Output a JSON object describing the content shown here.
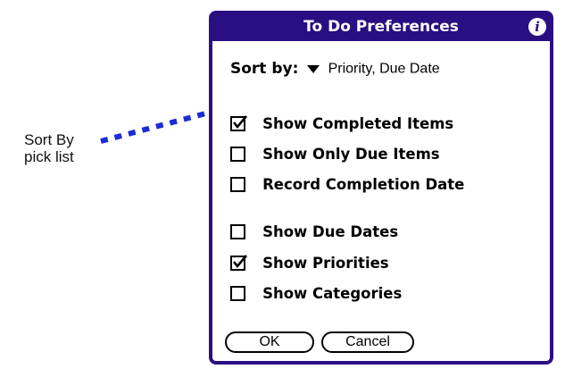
{
  "callout": {
    "line1": "Sort By",
    "line2": "pick list"
  },
  "dialog": {
    "title": "To Do Preferences",
    "info_icon": "i"
  },
  "sort": {
    "label": "Sort by:",
    "value": "Priority, Due Date"
  },
  "options": [
    {
      "label": "Show Completed Items",
      "checked": true
    },
    {
      "label": "Show Only Due Items",
      "checked": false
    },
    {
      "label": "Record Completion Date",
      "checked": false
    },
    {
      "label": "Show Due Dates",
      "checked": false
    },
    {
      "label": "Show Priorities",
      "checked": true
    },
    {
      "label": "Show Categories",
      "checked": false
    }
  ],
  "buttons": {
    "ok": "OK",
    "cancel": "Cancel"
  },
  "colors": {
    "dialog_frame": "#2a0f82",
    "callout_line": "#1a2bd8"
  },
  "icons": {
    "info": "info-icon",
    "dropdown": "dropdown-triangle-icon",
    "check": "checkmark-icon"
  }
}
